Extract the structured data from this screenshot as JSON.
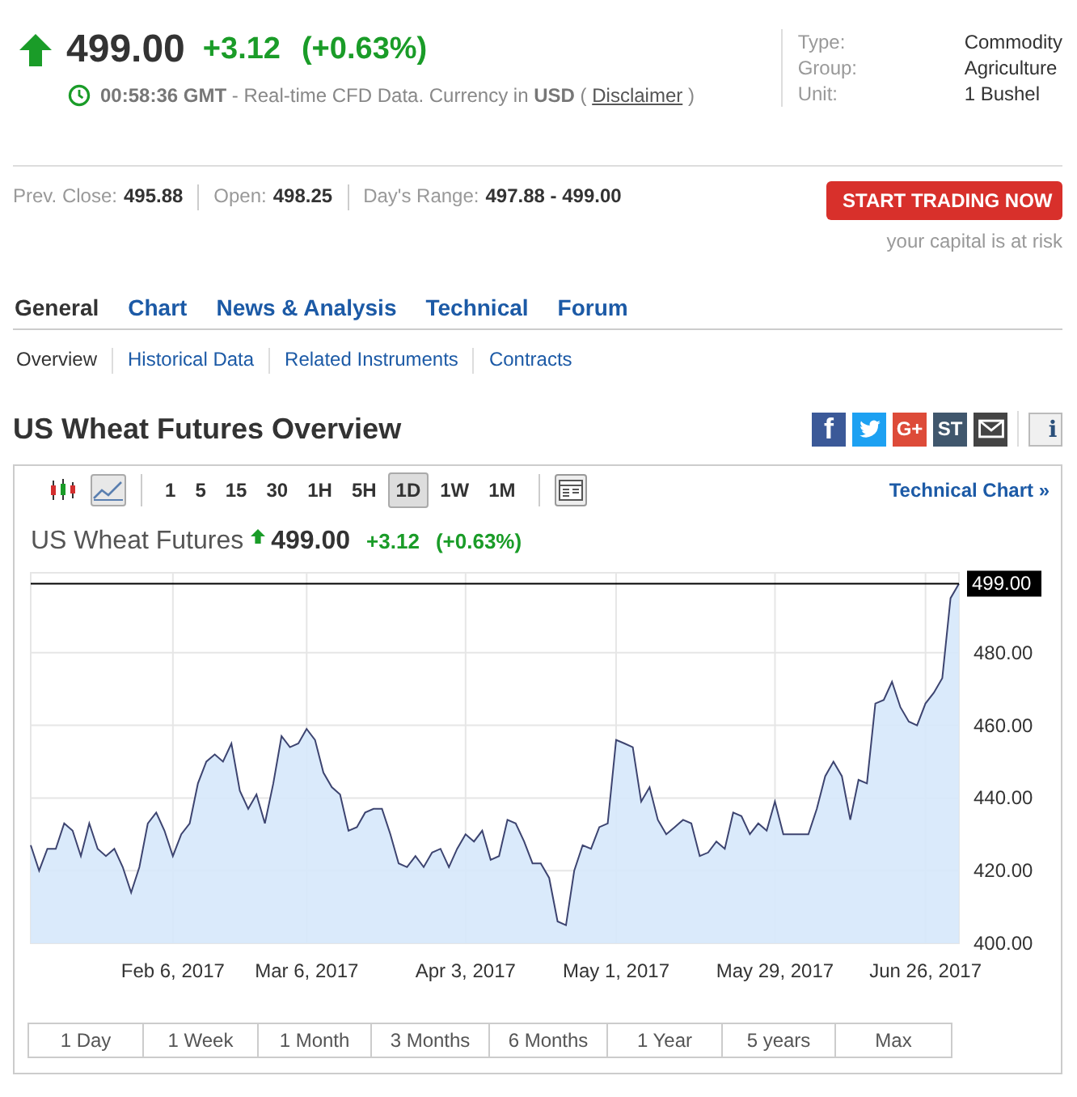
{
  "quote": {
    "rising": true,
    "price": "499.00",
    "change": "+3.12",
    "change_pct": "(+0.63%)",
    "time_note": "**00:58:36 GMT** - Real-time CFD Data. Currency in **USD** (",
    "disclaimer_link": "Disclaimer",
    "note_end": ")"
  },
  "info": [
    {
      "label": "Type:",
      "value": "Commodity"
    },
    {
      "label": "Group:",
      "value": "Agriculture"
    },
    {
      "label": "Unit:",
      "value": "1 Bushel"
    }
  ],
  "stats": [
    {
      "label": "Prev. Close:",
      "value": "495.88"
    },
    {
      "label": "Open:",
      "value": "498.25"
    },
    {
      "label": "Day's Range:",
      "value": "497.88 - 499.00"
    }
  ],
  "cta": {
    "button": "START TRADING NOW",
    "note": "your capital is at risk"
  },
  "tabs": [
    {
      "label": "General",
      "selected": true
    },
    {
      "label": "Chart",
      "selected": false
    },
    {
      "label": "News & Analysis",
      "selected": false
    },
    {
      "label": "Technical",
      "selected": false
    },
    {
      "label": "Forum",
      "selected": false
    }
  ],
  "subtabs": [
    {
      "label": "Overview",
      "selected": true
    },
    {
      "label": "Historical Data",
      "selected": false
    },
    {
      "label": "Related Instruments",
      "selected": false
    },
    {
      "label": "Contracts",
      "selected": false
    }
  ],
  "title": "US Wheat Futures Overview",
  "share_buttons": [
    {
      "kind": "facebook",
      "text": "f"
    },
    {
      "kind": "twitter"
    },
    {
      "kind": "gplus",
      "text": "G+"
    },
    {
      "kind": "stocktwits",
      "text": "ST"
    },
    {
      "kind": "email"
    },
    {
      "kind": "info",
      "text": "i"
    }
  ],
  "toolbar": {
    "chart_types": [
      {
        "kind": "candles",
        "selected": false
      },
      {
        "kind": "line",
        "selected": true
      }
    ],
    "intervals": [
      {
        "label": "1",
        "selected": false
      },
      {
        "label": "5",
        "selected": false
      },
      {
        "label": "15",
        "selected": false
      },
      {
        "label": "30",
        "selected": false
      },
      {
        "label": "1H",
        "selected": false
      },
      {
        "label": "5H",
        "selected": false
      },
      {
        "label": "1D",
        "selected": true
      },
      {
        "label": "1W",
        "selected": false
      },
      {
        "label": "1M",
        "selected": false
      }
    ],
    "link": "Technical Chart »"
  },
  "chart_header": {
    "name": "US Wheat Futures",
    "rising": true,
    "price": "499.00",
    "change": "+3.12",
    "change_pct": "(+0.63%)"
  },
  "chart_data": {
    "type": "area",
    "grid": true,
    "ylim": [
      400,
      502
    ],
    "categories": [
      null,
      null,
      null,
      null,
      null,
      null,
      null,
      null,
      null,
      null,
      null,
      null,
      null,
      null,
      null,
      null,
      null,
      "Feb 6, 2017",
      null,
      null,
      null,
      null,
      null,
      null,
      null,
      null,
      null,
      null,
      null,
      null,
      null,
      null,
      null,
      "Mar 6, 2017",
      null,
      null,
      null,
      null,
      null,
      null,
      null,
      null,
      null,
      null,
      null,
      null,
      null,
      null,
      null,
      null,
      null,
      null,
      "Apr 3, 2017",
      null,
      null,
      null,
      null,
      null,
      null,
      null,
      null,
      null,
      null,
      null,
      null,
      null,
      null,
      null,
      null,
      null,
      "May 1, 2017",
      null,
      null,
      null,
      null,
      null,
      null,
      null,
      null,
      null,
      null,
      null,
      null,
      null,
      null,
      null,
      null,
      null,
      null,
      "May 29, 2017",
      null,
      null,
      null,
      null,
      null,
      null,
      null,
      null,
      null,
      null,
      null,
      null,
      null,
      null,
      null,
      null,
      null,
      "Jun 26, 2017",
      null,
      null,
      null,
      null
    ],
    "yticks": [
      {
        "value": 400,
        "label": "400.00"
      },
      {
        "value": 420,
        "label": "420.00"
      },
      {
        "value": 440,
        "label": "440.00"
      },
      {
        "value": 460,
        "label": "460.00"
      },
      {
        "value": 480,
        "label": "480.00"
      }
    ],
    "series": [
      {
        "color": "#3d4470",
        "values": [
          427,
          420,
          426,
          426,
          433,
          431,
          424,
          433,
          426,
          424,
          426,
          421,
          414,
          421,
          433,
          436,
          431,
          424,
          430,
          433,
          444,
          450,
          452,
          450,
          455,
          442,
          437,
          441,
          433,
          444,
          457,
          454,
          455,
          459,
          456,
          447,
          443,
          441,
          431,
          432,
          436,
          437,
          437,
          430,
          422,
          421,
          424,
          421,
          425,
          426,
          421,
          426,
          430,
          428,
          431,
          423,
          424,
          434,
          433,
          428,
          422,
          422,
          418,
          406,
          405,
          420,
          427,
          426,
          432,
          433,
          456,
          455,
          454,
          439,
          443,
          434,
          430,
          432,
          434,
          433,
          424,
          425,
          428,
          426,
          436,
          435,
          430,
          433,
          431,
          439,
          430,
          430,
          430,
          430,
          437,
          446,
          450,
          446,
          434,
          445,
          444,
          466,
          467,
          472,
          465,
          461,
          460,
          466,
          469,
          473,
          495,
          499
        ]
      }
    ],
    "ref_lines": [
      {
        "axis": "y",
        "value": 499,
        "label": "499.00",
        "color": "#000000"
      }
    ]
  },
  "ranges": [
    "1 Day",
    "1 Week",
    "1 Month",
    "3 Months",
    "6 Months",
    "1 Year",
    "5 years",
    "Max"
  ]
}
